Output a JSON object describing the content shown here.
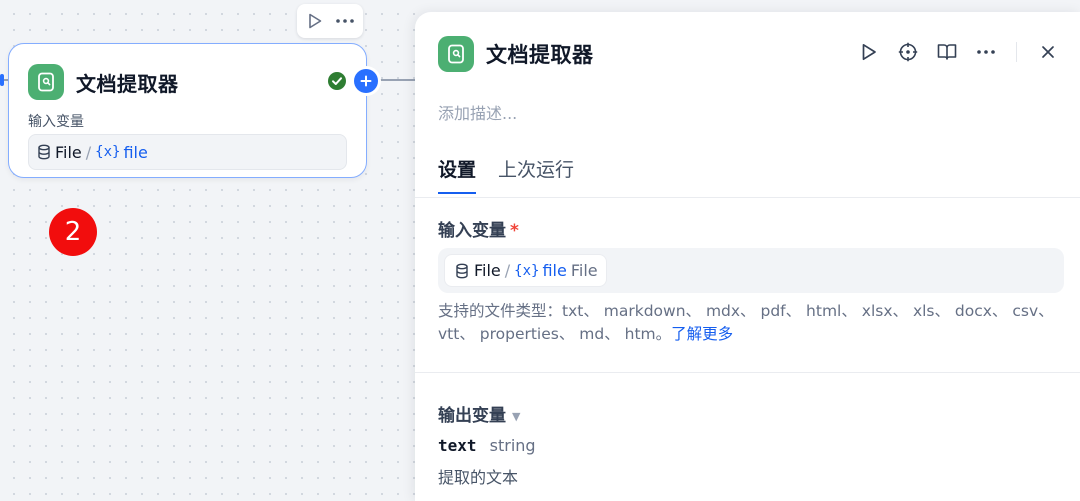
{
  "node": {
    "title": "文档提取器",
    "input_label": "输入变量",
    "var_source": "File",
    "var_separator": "/",
    "var_token": "{x}",
    "var_name": "file",
    "step_badge": "2"
  },
  "panel": {
    "title": "文档提取器",
    "description_placeholder": "添加描述...",
    "tabs": [
      "设置",
      "上次运行"
    ],
    "input_section": {
      "label": "输入变量",
      "required_mark": "*",
      "chip_source": "File",
      "chip_separator": "/",
      "chip_token": "{x}",
      "chip_name": "file",
      "chip_type": "File"
    },
    "hint_text": "支持的文件类型：txt、 markdown、 mdx、 pdf、 html、 xlsx、 xls、 docx、 csv、 vtt、 properties、 md、 htm。",
    "hint_link": "了解更多",
    "output_section": {
      "label": "输出变量",
      "var_name": "text",
      "var_type": "string",
      "var_desc": "提取的文本"
    }
  },
  "colors": {
    "accent": "#155eef",
    "node_icon": "#4caf72",
    "success": "#2e7d32",
    "badge": "#f20d0d"
  }
}
